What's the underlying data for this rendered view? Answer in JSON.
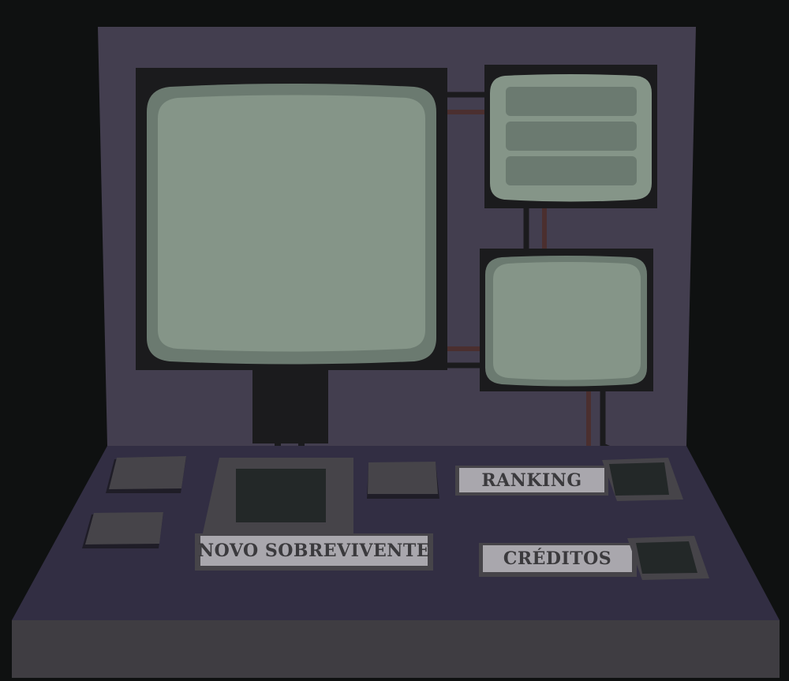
{
  "menu": {
    "new_survivor_label": "NOVO SOBREVIVENTE",
    "ranking_label": "RANKING",
    "credits_label": "CRÉDITOS"
  },
  "colors": {
    "background": "#0f1111",
    "back_panel": "#433e4f",
    "desk_top": "#322e43",
    "desk_front": "#3f3d42",
    "monitor_bezel": "#1b1b1d",
    "screen_outer": "#6b7a70",
    "screen_inner": "#859588",
    "label_plate": "#a9a7ad",
    "button_slot": "#464449",
    "cable_red": "#4b2f2f"
  }
}
